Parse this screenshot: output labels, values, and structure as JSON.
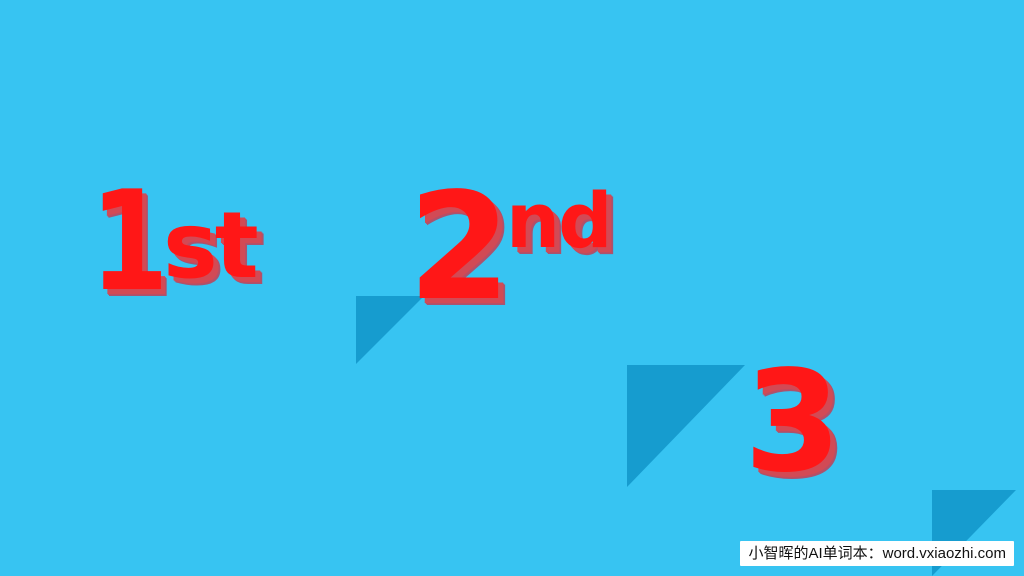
{
  "ranks": {
    "first": {
      "number": "1",
      "suffix": "st"
    },
    "second": {
      "number": "2",
      "suffix": "nd"
    },
    "third": {
      "number": "3"
    }
  },
  "watermark": {
    "text": "小智晖的AI单词本：word.vxiaozhi.com"
  },
  "colors": {
    "background": "#37c4f2",
    "number_red": "#ff1717",
    "shadow": "#b94e64",
    "triangle": "#169ccf",
    "watermark_background": "#ffffff",
    "watermark_text": "#111111"
  }
}
